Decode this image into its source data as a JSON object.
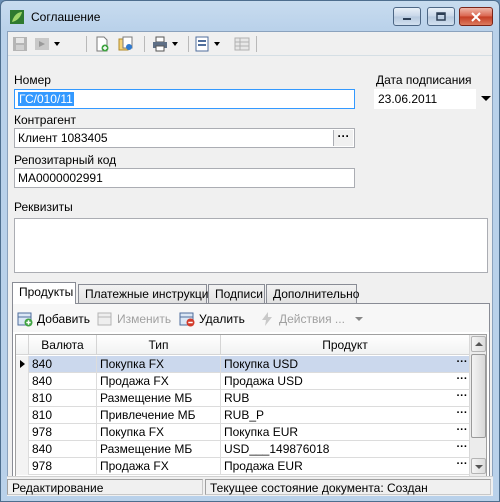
{
  "window": {
    "title": "Соглашение"
  },
  "form": {
    "number_label": "Номер",
    "number_value": "ГС/010/11",
    "sign_date_label": "Дата подписания",
    "sign_date_value": "23.06.2011",
    "counterparty_label": "Контрагент",
    "counterparty_value": "Клиент 1083405",
    "repo_code_label": "Репозитарный код",
    "repo_code_value": "MA0000002991",
    "requisites_label": "Реквизиты",
    "requisites_value": "",
    "ellipsis": "···"
  },
  "tabs": [
    {
      "label": "Продукты",
      "active": true
    },
    {
      "label": "Платежные инструкции",
      "active": false
    },
    {
      "label": "Подписи",
      "active": false
    },
    {
      "label": "Дополнительно",
      "active": false
    }
  ],
  "grid_toolbar": {
    "add": "Добавить",
    "edit": "Изменить",
    "delete": "Удалить",
    "actions": "Действия ..."
  },
  "grid": {
    "columns": [
      "Валюта",
      "Тип",
      "Продукт"
    ],
    "rows": [
      {
        "currency": "840",
        "type": "Покупка FX",
        "product": "Покупка USD",
        "current": true
      },
      {
        "currency": "840",
        "type": "Продажа FX",
        "product": "Продажа USD",
        "current": false
      },
      {
        "currency": "810",
        "type": "Размещение МБ",
        "product": "RUB",
        "current": false
      },
      {
        "currency": "810",
        "type": "Привлечение МБ",
        "product": "RUB_P",
        "current": false
      },
      {
        "currency": "978",
        "type": "Покупка FX",
        "product": "Покупка EUR",
        "current": false
      },
      {
        "currency": "840",
        "type": "Размещение МБ",
        "product": "USD___149876018",
        "current": false
      },
      {
        "currency": "978",
        "type": "Продажа FX",
        "product": "Продажа EUR",
        "current": false
      }
    ]
  },
  "status": {
    "mode": "Редактирование",
    "doc_state": "Текущее состояние документа: Создан"
  },
  "colors": {
    "selection": "#3399ff",
    "current_row": "#cbd8ed",
    "title_bar": "#b9d1ea",
    "close_button": "#c43c23"
  }
}
